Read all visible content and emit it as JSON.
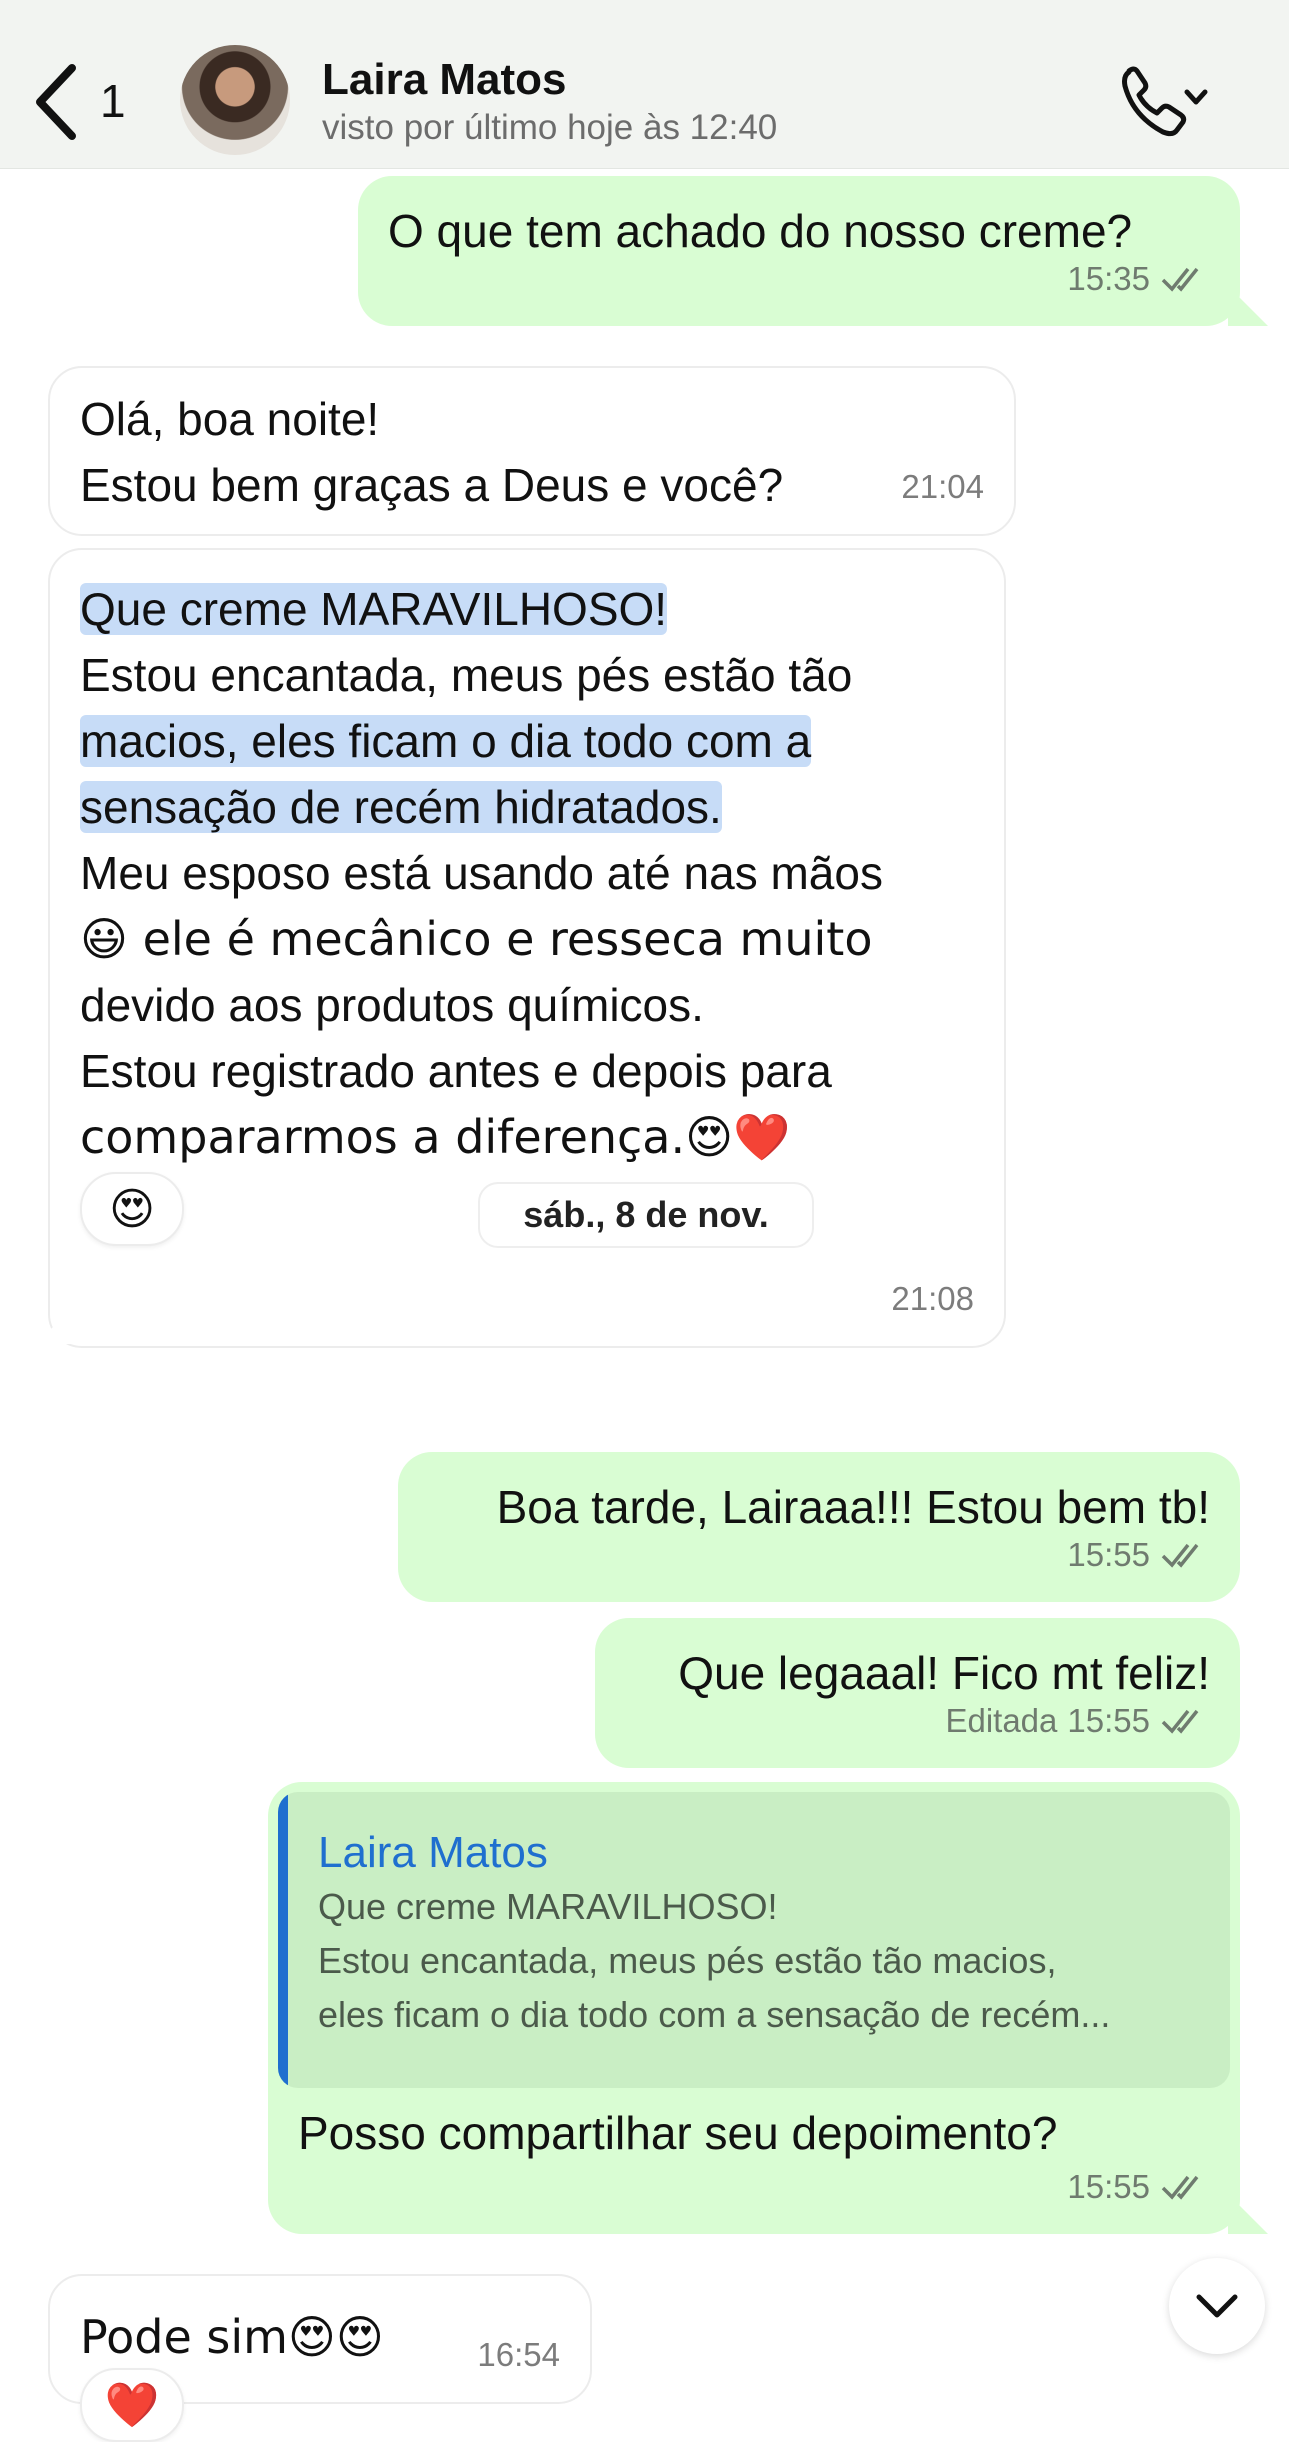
{
  "header": {
    "back_count": "1",
    "contact_name": "Laira Matos",
    "status": "visto por último hoje às 12:40"
  },
  "messages": [
    {
      "id": "m1",
      "direction": "out",
      "lines": [
        "O que tem achado do nosso creme?"
      ],
      "time": "15:35"
    },
    {
      "id": "m2",
      "direction": "in",
      "lines": [
        "Olá, boa noite!",
        "Estou bem graças a Deus e você?"
      ],
      "time": "21:04"
    },
    {
      "id": "m3",
      "direction": "in",
      "lines": [
        "Que creme MARAVILHOSO!",
        "Estou encantada, meus pés estão tão",
        "macios, eles ficam o dia todo com a",
        "sensação de recém hidratados.",
        "Meu esposo está usando até nas mãos",
        "😃 ele é mecânico e resseca muito",
        "devido aos produtos químicos.",
        "Estou registrado antes e depois para",
        "compararmos a diferença.😍❤️"
      ],
      "time": "21:08",
      "reaction": "😍"
    },
    {
      "id": "m4",
      "direction": "out",
      "lines": [
        "Boa tarde, Lairaaa!!! Estou bem tb!"
      ],
      "time": "15:55"
    },
    {
      "id": "m5",
      "direction": "out",
      "lines": [
        "Que legaaal! Fico mt feliz!"
      ],
      "edited": "Editada",
      "time": "15:55"
    },
    {
      "id": "m6",
      "direction": "out",
      "quote": {
        "author": "Laira Matos",
        "lines": [
          "Que creme MARAVILHOSO!",
          "Estou encantada, meus pés estão tão macios,",
          "eles ficam o dia todo com a sensação de recém..."
        ]
      },
      "lines": [
        "Posso compartilhar seu depoimento?"
      ],
      "time": "15:55"
    },
    {
      "id": "m7",
      "direction": "in",
      "lines": [
        "Pode sim😍😍"
      ],
      "time": "16:54",
      "reaction": "❤️"
    }
  ],
  "date_separator": "sáb., 8 de nov.",
  "icons": {
    "back": "chevron-left-icon",
    "call": "phone-icon",
    "call_menu": "chevron-down-icon",
    "read_status": "double-check-icon",
    "scroll_down": "chevron-down-icon"
  },
  "colors": {
    "outgoing_bubble": "#d9fdd3",
    "incoming_bubble": "#ffffff",
    "quote_accent": "#1f6fcf",
    "highlight": "#c7dcf7"
  }
}
